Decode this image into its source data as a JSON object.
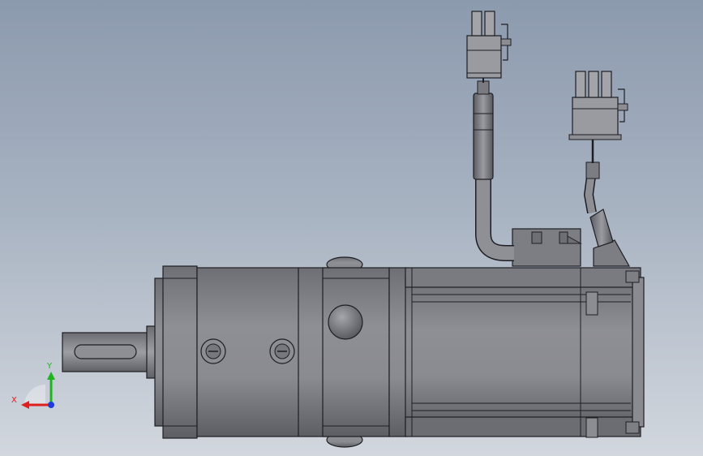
{
  "view": {
    "background_top": "#8c9aae",
    "background_bottom": "#d2d7de"
  },
  "triad": {
    "x_label": "X",
    "y_label": "Y",
    "x_color": "#e0201e",
    "y_color": "#1eb41e",
    "z_color": "#1e3cdc"
  },
  "model": {
    "body_color": "#7f8086",
    "edge_color": "#1e1e22"
  }
}
